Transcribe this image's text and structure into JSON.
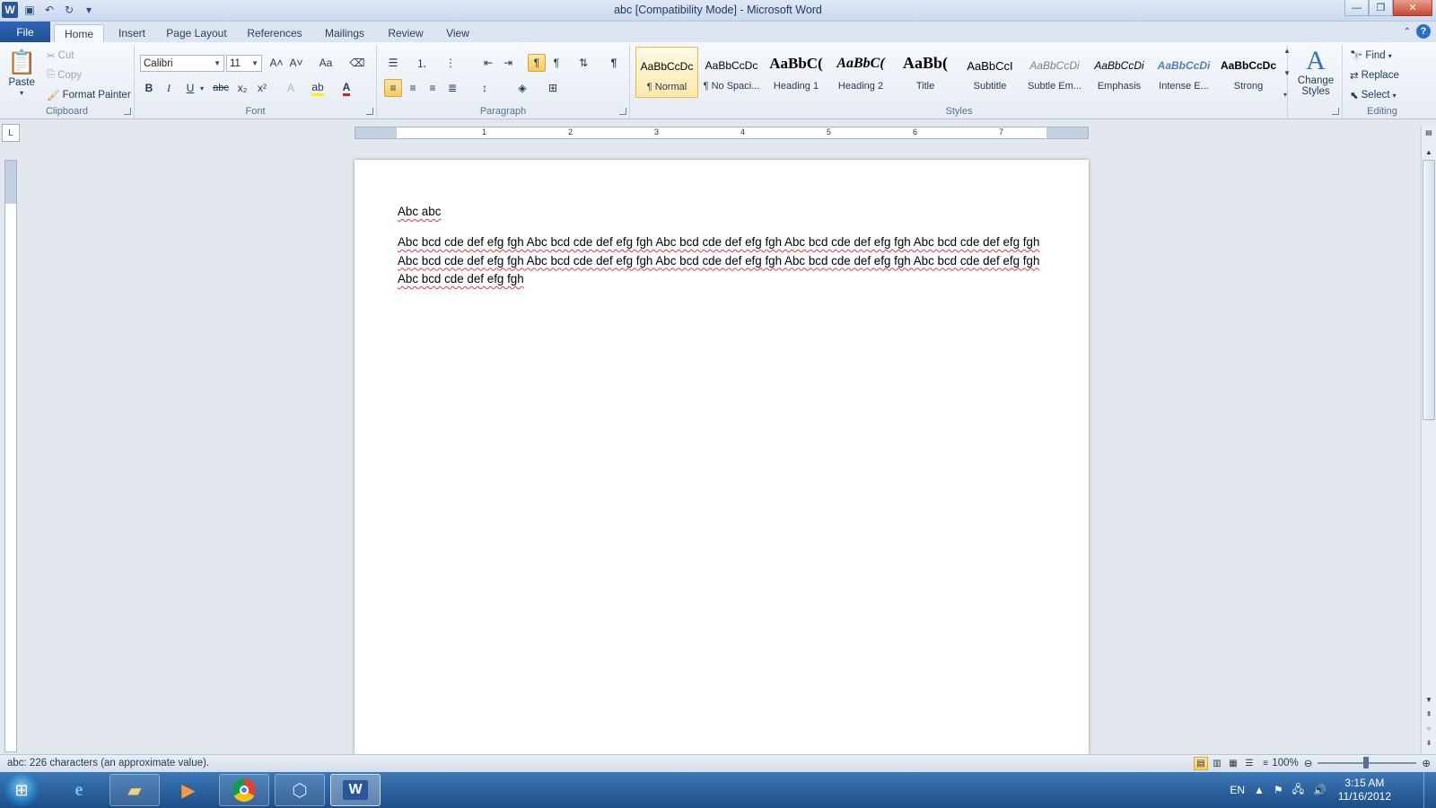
{
  "window": {
    "title": "abc [Compatibility Mode]  -  Microsoft Word",
    "qat_icons": [
      "word-logo-icon",
      "save-icon",
      "undo-icon",
      "redo-icon",
      "customize-qat-icon"
    ]
  },
  "tabs": {
    "file": "File",
    "items": [
      "Home",
      "Insert",
      "Page Layout",
      "References",
      "Mailings",
      "Review",
      "View"
    ],
    "active": "Home"
  },
  "ribbon": {
    "clipboard": {
      "label": "Clipboard",
      "paste": "Paste",
      "cut": "Cut",
      "copy": "Copy",
      "format_painter": "Format Painter"
    },
    "font": {
      "label": "Font",
      "font_name": "Calibri",
      "font_size": "11",
      "bold": "B",
      "italic": "I",
      "underline": "U",
      "strike": "abc",
      "subscript": "x₂",
      "superscript": "x²",
      "grow": "A˄",
      "shrink": "A˅",
      "change_case": "Aa"
    },
    "paragraph": {
      "label": "Paragraph"
    },
    "styles": {
      "label": "Styles",
      "items": [
        {
          "sample": "AaBbCcDc",
          "name": "¶ Normal"
        },
        {
          "sample": "AaBbCcDc",
          "name": "¶ No Spaci..."
        },
        {
          "sample": "AaBbC(",
          "name": "Heading 1"
        },
        {
          "sample": "AaBbC(",
          "name": "Heading 2"
        },
        {
          "sample": "AaBb(",
          "name": "Title"
        },
        {
          "sample": "AaBbCcI",
          "name": "Subtitle"
        },
        {
          "sample": "AaBbCcDi",
          "name": "Subtle Em..."
        },
        {
          "sample": "AaBbCcDi",
          "name": "Emphasis"
        },
        {
          "sample": "AaBbCcDi",
          "name": "Intense E..."
        },
        {
          "sample": "AaBbCcDc",
          "name": "Strong"
        }
      ],
      "change_styles": "Change Styles"
    },
    "editing": {
      "label": "Editing",
      "find": "Find",
      "replace": "Replace",
      "select": "Select"
    }
  },
  "ruler": {
    "numbers": [
      "1",
      "2",
      "3",
      "4",
      "5",
      "6",
      "7"
    ]
  },
  "document": {
    "line1": "Abc abc",
    "paragraph": "Abc bcd cde def efg fgh Abc bcd cde def efg fgh Abc bcd cde def efg fgh Abc bcd cde def efg fgh Abc bcd cde def efg fgh Abc bcd cde def efg fgh Abc bcd cde def efg fgh Abc bcd cde def efg fgh Abc bcd cde def efg fgh Abc bcd cde def efg fgh Abc bcd cde def efg fgh"
  },
  "statusbar": {
    "text": "abc: 226 characters (an approximate value).",
    "zoom": "100%"
  },
  "taskbar": {
    "apps": [
      "internet-explorer-icon",
      "file-explorer-icon",
      "media-player-icon",
      "chrome-icon",
      "virtualbox-icon",
      "word-icon"
    ],
    "active_app": "word-icon",
    "language": "EN",
    "time": "3:15 AM",
    "date": "11/16/2012"
  }
}
